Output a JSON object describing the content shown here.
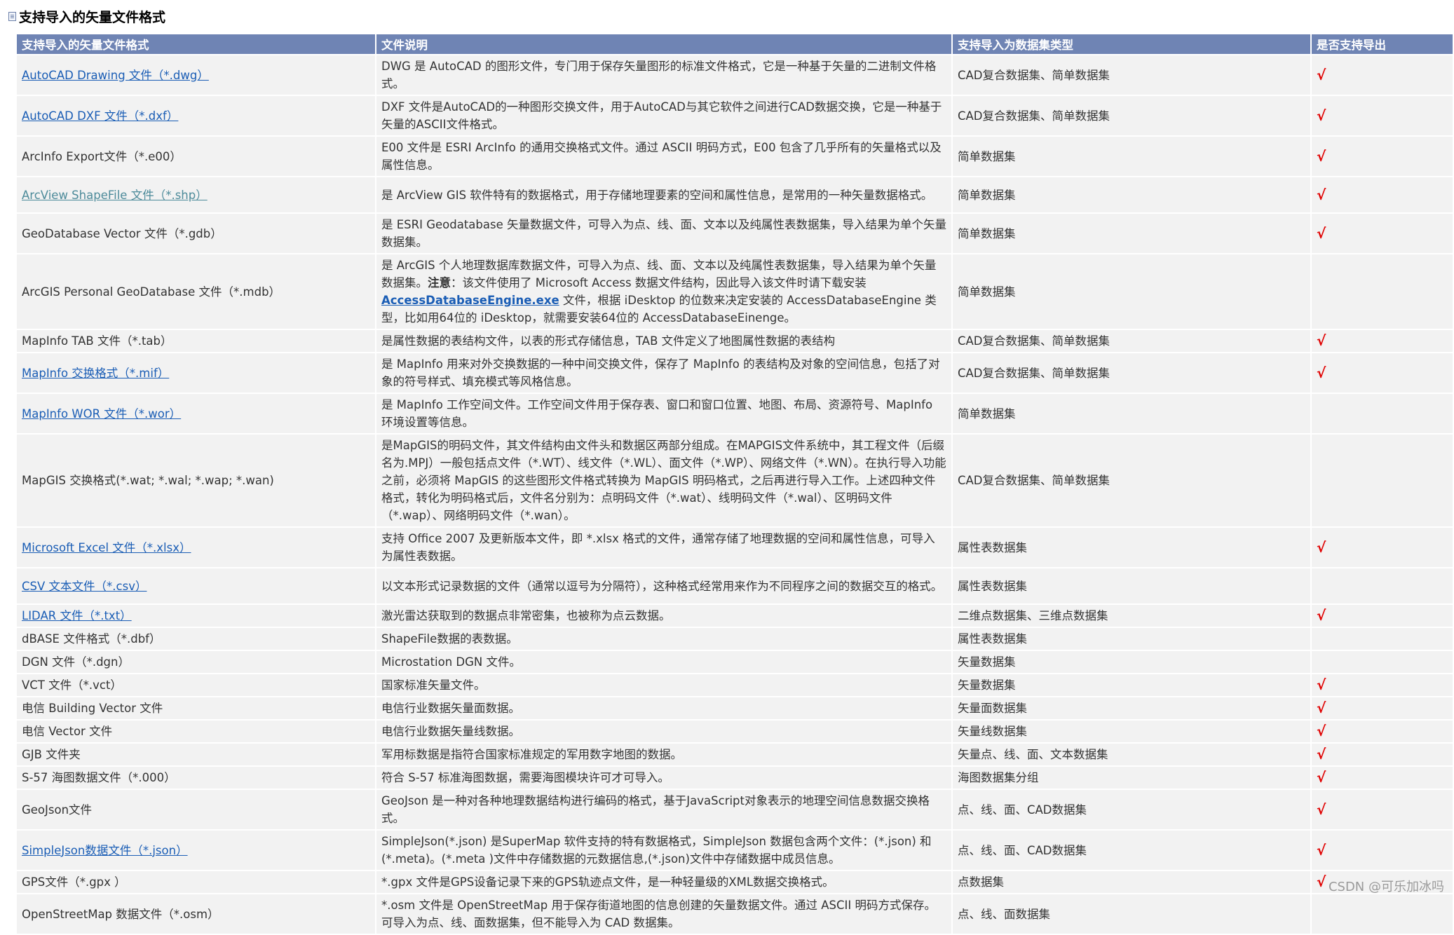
{
  "page": {
    "title": "支持导入的矢量文件格式",
    "watermark": "CSDN @可乐加冰吗"
  },
  "table": {
    "headers": [
      "支持导入的矢量文件格式",
      "文件说明",
      "支持导入为数据集类型",
      "是否支持导出"
    ],
    "rows": [
      {
        "format": "AutoCAD Drawing 文件（*.dwg）",
        "link": true,
        "desc": "DWG 是 AutoCAD 的图形文件，专门用于保存矢量图形的标准文件格式，它是一种基于矢量的二进制文件格式。",
        "type": "CAD复合数据集、简单数据集",
        "export": "√"
      },
      {
        "format": "AutoCAD DXF 文件（*.dxf）",
        "link": true,
        "desc": "DXF 文件是AutoCAD的一种图形交换文件，用于AutoCAD与其它软件之间进行CAD数据交换，它是一种基于矢量的ASCII文件格式。",
        "type": "CAD复合数据集、简单数据集",
        "export": "√"
      },
      {
        "format": "ArcInfo Export文件（*.e00）",
        "link": false,
        "desc": "E00 文件是 ESRI ArcInfo 的通用交换格式文件。通过 ASCII 明码方式，E00 包含了几乎所有的矢量格式以及属性信息。",
        "type": "简单数据集",
        "export": "√"
      },
      {
        "format": "ArcView ShapeFile 文件（*.shp）",
        "link": true,
        "visited": true,
        "desc": "是 ArcView GIS 软件特有的数据格式，用于存储地理要素的空间和属性信息，是常用的一种矢量数据格式。",
        "type": "简单数据集",
        "export": "√"
      },
      {
        "format": "GeoDatabase Vector 文件（*.gdb）",
        "link": false,
        "desc": "是 ESRI Geodatabase 矢量数据文件，可导入为点、线、面、文本以及纯属性表数据集，导入结果为单个矢量数据集。",
        "type": "简单数据集",
        "export": "√"
      },
      {
        "format": "ArcGIS Personal GeoDatabase 文件（*.mdb）",
        "link": false,
        "desc": "是 ArcGIS 个人地理数据库数据文件，可导入为点、线、面、文本以及纯属性表数据集，导入结果为单个矢量数据集。",
        "note_label": "注意",
        "note_text": "：该文件使用了 Microsoft Access 数据文件结构，因此导入该文件时请下载安装 ",
        "note_link": "AccessDatabaseEngine.exe",
        "note_tail": " 文件，根据 iDesktop 的位数来决定安装的 AccessDatabaseEngine 类型，比如用64位的 iDesktop，就需要安装64位的 AccessDatabaseEinenge。",
        "type": "简单数据集",
        "export": ""
      },
      {
        "format": "MapInfo TAB 文件（*.tab）",
        "link": false,
        "desc": "是属性数据的表结构文件，以表的形式存储信息，TAB 文件定义了地图属性数据的表结构",
        "type": "CAD复合数据集、简单数据集",
        "export": "√"
      },
      {
        "format": "MapInfo 交换格式（*.mif）",
        "link": true,
        "desc": "是 MapInfo 用来对外交换数据的一种中间交换文件，保存了 MapInfo 的表结构及对象的空间信息，包括了对象的符号样式、填充模式等风格信息。",
        "type": "CAD复合数据集、简单数据集",
        "export": "√"
      },
      {
        "format": "MapInfo WOR 文件（*.wor）",
        "link": true,
        "desc": "是 MapInfo 工作空间文件。工作空间文件用于保存表、窗口和窗口位置、地图、布局、资源符号、MapInfo 环境设置等信息。",
        "type": "简单数据集",
        "export": ""
      },
      {
        "format": "MapGIS 交换格式(*.wat; *.wal; *.wap; *.wan)",
        "link": false,
        "desc": "是MapGIS的明码文件，其文件结构由文件头和数据区两部分组成。在MAPGIS文件系统中，其工程文件（后缀名为.MPJ）一般包括点文件（*.WT）、线文件（*.WL）、面文件（*.WP）、网络文件（*.WN）。在执行导入功能之前，必须将 MapGIS 的这些图形文件格式转换为 MapGIS 明码格式，之后再进行导入工作。上述四种文件格式，转化为明码格式后，文件名分别为：点明码文件（*.wat）、线明码文件（*.wal）、区明码文件（*.wap）、网络明码文件（*.wan）。",
        "type": "CAD复合数据集、简单数据集",
        "export": ""
      },
      {
        "format": "Microsoft Excel 文件（*.xlsx）",
        "link": true,
        "desc": "支持 Office 2007 及更新版本文件，即 *.xlsx 格式的文件，通常存储了地理数据的空间和属性信息，可导入为属性表数据。",
        "type": "属性表数据集",
        "export": "√"
      },
      {
        "format": "CSV 文本文件（*.csv）",
        "link": true,
        "desc": "以文本形式记录数据的文件（通常以逗号为分隔符），这种格式经常用来作为不同程序之间的数据交互的格式。",
        "type": "属性表数据集",
        "export": ""
      },
      {
        "format": "LIDAR 文件（*.txt）",
        "link": true,
        "desc": "激光雷达获取到的数据点非常密集，也被称为点云数据。",
        "type": "二维点数据集、三维点数据集",
        "export": "√"
      },
      {
        "format": "dBASE 文件格式（*.dbf）",
        "link": false,
        "desc": "ShapeFile数据的表数据。",
        "type": "属性表数据集",
        "export": ""
      },
      {
        "format": "DGN 文件（*.dgn）",
        "link": false,
        "desc": "Microstation DGN 文件。",
        "type": "矢量数据集",
        "export": ""
      },
      {
        "format": "VCT 文件（*.vct）",
        "link": false,
        "desc": "国家标准矢量文件。",
        "type": "矢量数据集",
        "export": "√"
      },
      {
        "format": "电信 Building Vector 文件",
        "link": false,
        "desc": "电信行业数据矢量面数据。",
        "type": "矢量面数据集",
        "export": "√"
      },
      {
        "format": "电信 Vector 文件",
        "link": false,
        "desc": "电信行业数据矢量线数据。",
        "type": "矢量线数据集",
        "export": "√"
      },
      {
        "format": "GJB 文件夹",
        "link": false,
        "desc": "军用标数据是指符合国家标准规定的军用数字地图的数据。",
        "type": "矢量点、线、面、文本数据集",
        "export": "√"
      },
      {
        "format": "S-57 海图数据文件（*.000）",
        "link": false,
        "desc": "符合 S-57 标准海图数据，需要海图模块许可才可导入。",
        "type": "海图数据集分组",
        "export": "√"
      },
      {
        "format": "GeoJson文件",
        "link": false,
        "desc": "GeoJson 是一种对各种地理数据结构进行编码的格式，基于JavaScript对象表示的地理空间信息数据交换格式。",
        "type": "点、线、面、CAD数据集",
        "export": "√"
      },
      {
        "format": "SimpleJson数据文件（*.json）",
        "link": true,
        "desc": "SimpleJson(*.json) 是SuperMap 软件支持的特有数据格式，SimpleJson 数据包含两个文件：(*.json) 和 (*.meta)。(*.meta )文件中存储数据的元数据信息,(*.json)文件中存储数据中成员信息。",
        "type": "点、线、面、CAD数据集",
        "export": "√"
      },
      {
        "format": "GPS文件（*.gpx ）",
        "link": false,
        "desc": "*.gpx 文件是GPS设备记录下来的GPS轨迹点文件，是一种轻量级的XML数据交换格式。",
        "type": "点数据集",
        "export": "√"
      },
      {
        "format": "OpenStreetMap 数据文件（*.osm）",
        "link": false,
        "desc": "*.osm 文件是 OpenStreetMap 用于保存街道地图的信息创建的矢量数据文件。通过 ASCII 明码方式保存。可导入为点、线、面数据集，但不能导入为 CAD 数据集。",
        "type": "点、线、面数据集",
        "export": ""
      }
    ]
  }
}
